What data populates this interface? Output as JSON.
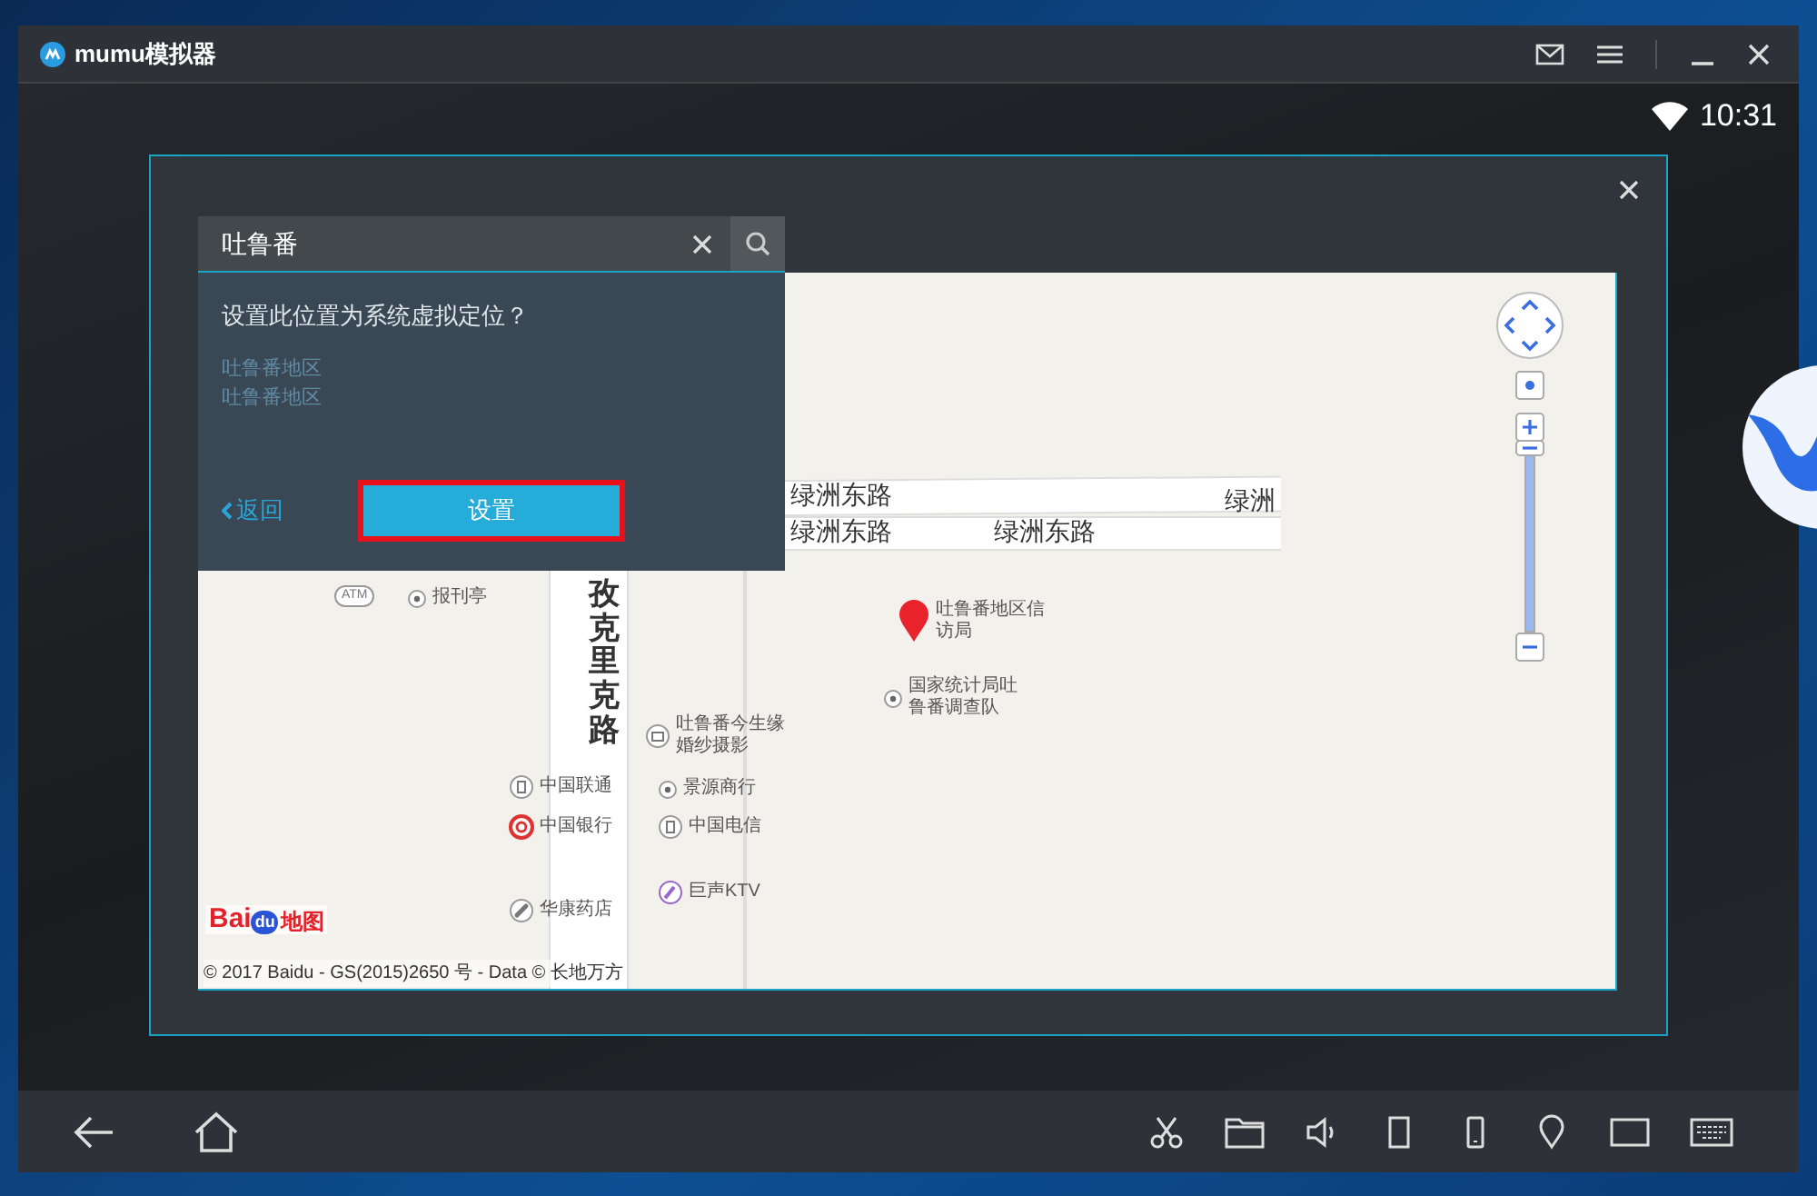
{
  "window": {
    "title": "mumu模拟器"
  },
  "status_bar": {
    "time": "10:31"
  },
  "location_dialog": {
    "search": {
      "value": "吐鲁番"
    },
    "popup": {
      "question": "设置此位置为系统虚拟定位？",
      "lines": [
        "吐鲁番地区",
        "吐鲁番地区"
      ],
      "back": "返回",
      "set_button": {
        "label": "设置",
        "highlighted": true
      }
    },
    "map": {
      "road_labels": [
        {
          "text": "绿洲东路",
          "kind": "horizontal"
        },
        {
          "text": "绿洲",
          "kind": "horizontal"
        },
        {
          "text": "绿洲东路",
          "kind": "horizontal"
        },
        {
          "text": "绿洲东路",
          "kind": "horizontal"
        },
        {
          "text": "孜克里克路",
          "kind": "vertical"
        }
      ],
      "places": [
        {
          "text": "ATM",
          "kind": "atm"
        },
        {
          "text": "报刊亭",
          "kind": "dot"
        },
        {
          "text": "吐鲁番地区信访局",
          "kind": "pin"
        },
        {
          "text": "国家统计局吐鲁番调查队",
          "kind": "dot"
        },
        {
          "text": "吐鲁番今生缘婚纱摄影",
          "kind": "camera"
        },
        {
          "text": "中国联通",
          "kind": "phone"
        },
        {
          "text": "景源商行",
          "kind": "dot"
        },
        {
          "text": "中国银行",
          "kind": "bank"
        },
        {
          "text": "中国电信",
          "kind": "phone"
        },
        {
          "text": "巨声KTV",
          "kind": "mic"
        },
        {
          "text": "华康药店",
          "kind": "pill"
        }
      ],
      "logo": {
        "part_1": "Bai",
        "part_2": "du",
        "part_3": "地图"
      },
      "copyright": "© 2017 Baidu - GS(2015)2650 号 - Data © 长地万方",
      "zoom_slider": {
        "level": 1
      }
    }
  }
}
